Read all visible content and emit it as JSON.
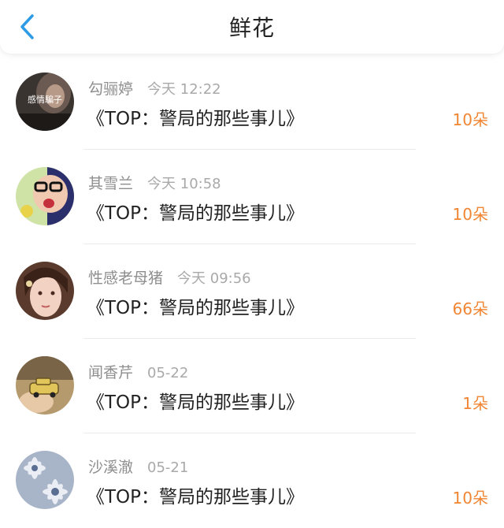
{
  "header": {
    "title": "鲜花",
    "back_icon": "chevron-left-icon",
    "accent_color": "#2e9be6"
  },
  "colors": {
    "count": "#f08533",
    "name": "#8e8e8e",
    "time": "#a9a9a9",
    "title": "#222222"
  },
  "items": [
    {
      "name": "勾骊婷",
      "time": "今天 12:22",
      "title": "《TOP：警局的那些事儿》",
      "count": "10朵",
      "avatar_text": "感情騙子"
    },
    {
      "name": "其雪兰",
      "time": "今天 10:58",
      "title": "《TOP：警局的那些事儿》",
      "count": "10朵"
    },
    {
      "name": "性感老母猪",
      "time": "今天 09:56",
      "title": "《TOP：警局的那些事儿》",
      "count": "66朵"
    },
    {
      "name": "闻香芹",
      "time": "05-22",
      "title": "《TOP：警局的那些事儿》",
      "count": "1朵"
    },
    {
      "name": "沙溪澈",
      "time": "05-21",
      "title": "《TOP：警局的那些事儿》",
      "count": "10朵"
    }
  ]
}
